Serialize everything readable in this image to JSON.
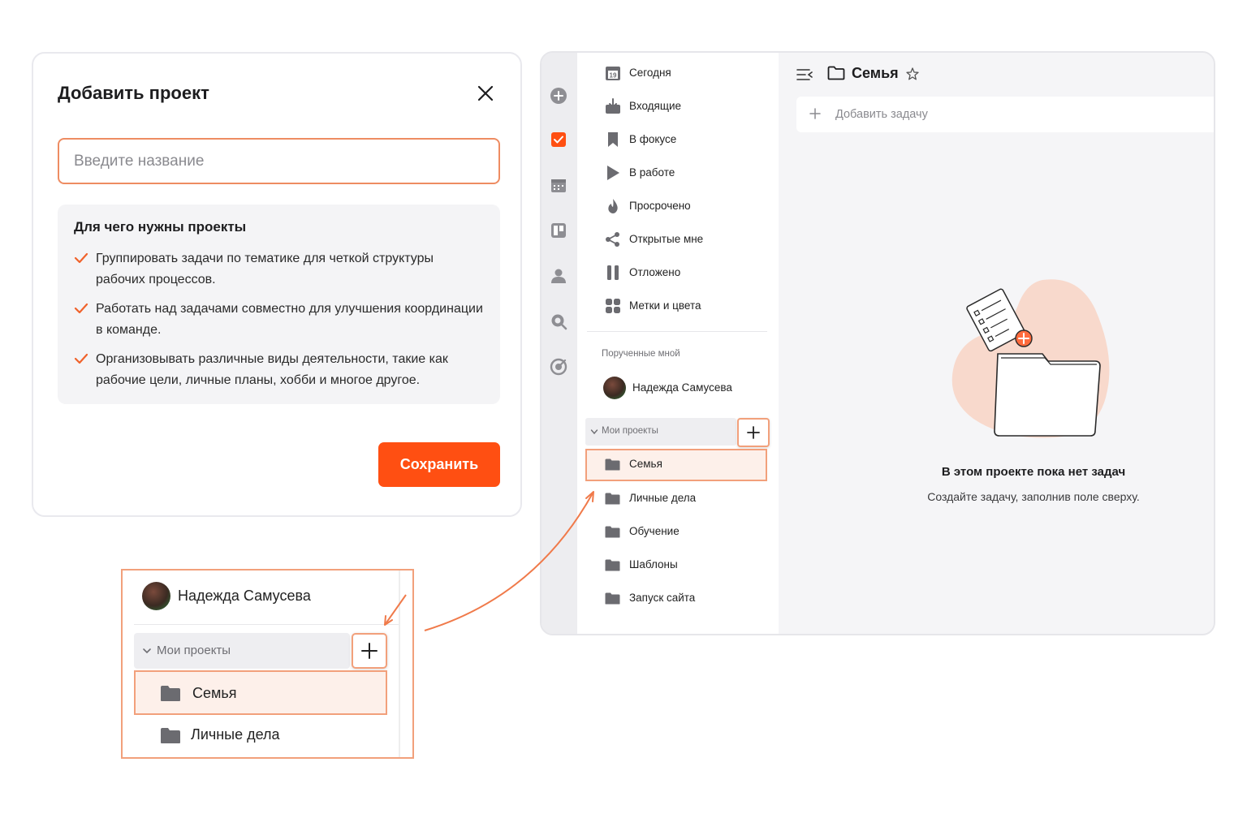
{
  "dialog": {
    "title": "Добавить проект",
    "input_placeholder": "Введите название",
    "info_title": "Для чего нужны проекты",
    "info_items": [
      "Группировать задачи по тематике для четкой структуры рабочих процессов.",
      "Работать над задачами совместно для улучшения координации в команде.",
      "Организовывать различные виды деятельности, такие как рабочие цели, личные планы, хобби и многое другое."
    ],
    "save_label": "Сохранить"
  },
  "sidebar": {
    "nav": [
      {
        "label": "Сегодня",
        "icon": "calendar-today-icon"
      },
      {
        "label": "Входящие",
        "icon": "inbox-icon"
      },
      {
        "label": "В фокусе",
        "icon": "bookmark-icon"
      },
      {
        "label": "В работе",
        "icon": "play-icon"
      },
      {
        "label": "Просрочено",
        "icon": "fire-icon"
      },
      {
        "label": "Открытые мне",
        "icon": "share-icon"
      },
      {
        "label": "Отложено",
        "icon": "pause-icon"
      },
      {
        "label": "Метки и цвета",
        "icon": "tags-grid-icon"
      }
    ],
    "today_badge": "19",
    "assigned_section": "Порученные мной",
    "user_name": "Надежда Самусева",
    "projects_group": "Мои проекты",
    "projects": [
      "Семья",
      "Личные дела",
      "Обучение",
      "Шаблоны",
      "Запуск сайта"
    ],
    "active_project": "Семья"
  },
  "main": {
    "title": "Семья",
    "add_task_placeholder": "Добавить задачу",
    "empty_title": "В этом проекте пока нет задач",
    "empty_subtitle": "Создайте задачу, заполнив поле сверху."
  },
  "callout": {
    "user_name": "Надежда Самусева",
    "projects_group": "Мои проекты",
    "projects": [
      "Семья",
      "Личные дела"
    ]
  },
  "colors": {
    "accent": "#ff4f12",
    "highlight_border": "#f2a07b",
    "highlight_bg": "#fdf0ea",
    "check": "#f0622b"
  }
}
